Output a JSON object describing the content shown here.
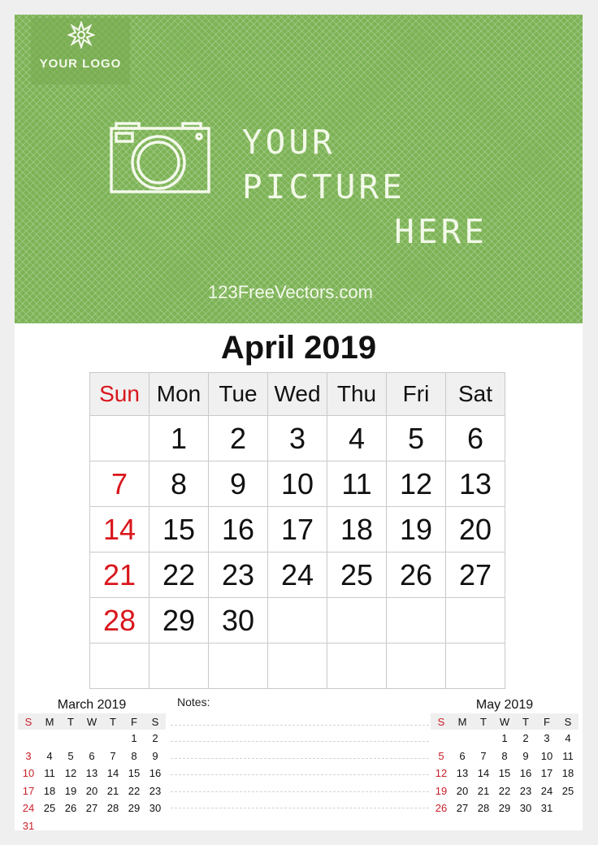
{
  "header": {
    "logo_text": "YOUR LOGO",
    "logo_icon": "flower-icon",
    "picture_line1": "YOUR PICTURE",
    "picture_line2": "HERE",
    "picture_icon": "camera-icon",
    "website": "123FreeVectors.com",
    "background_color": "#7db356"
  },
  "main": {
    "title": "April 2019",
    "weekdays": [
      "Sun",
      "Mon",
      "Tue",
      "Wed",
      "Thu",
      "Fri",
      "Sat"
    ],
    "weeks": [
      [
        "",
        "1",
        "2",
        "3",
        "4",
        "5",
        "6"
      ],
      [
        "7",
        "8",
        "9",
        "10",
        "11",
        "12",
        "13"
      ],
      [
        "14",
        "15",
        "16",
        "17",
        "18",
        "19",
        "20"
      ],
      [
        "21",
        "22",
        "23",
        "24",
        "25",
        "26",
        "27"
      ],
      [
        "28",
        "29",
        "30",
        "",
        "",
        "",
        ""
      ],
      [
        "",
        "",
        "",
        "",
        "",
        "",
        ""
      ]
    ],
    "sunday_color": "#d9161c"
  },
  "prev_month": {
    "title": "March 2019",
    "weekdays": [
      "S",
      "M",
      "T",
      "W",
      "T",
      "F",
      "S"
    ],
    "weeks": [
      [
        "",
        "",
        "",
        "",
        "",
        "1",
        "2"
      ],
      [
        "3",
        "4",
        "5",
        "6",
        "7",
        "8",
        "9"
      ],
      [
        "10",
        "11",
        "12",
        "13",
        "14",
        "15",
        "16"
      ],
      [
        "17",
        "18",
        "19",
        "20",
        "21",
        "22",
        "23"
      ],
      [
        "24",
        "25",
        "26",
        "27",
        "28",
        "29",
        "30"
      ],
      [
        "31",
        "",
        "",
        "",
        "",
        "",
        ""
      ]
    ]
  },
  "next_month": {
    "title": "May 2019",
    "weekdays": [
      "S",
      "M",
      "T",
      "W",
      "T",
      "F",
      "S"
    ],
    "weeks": [
      [
        "",
        "",
        "",
        "1",
        "2",
        "3",
        "4"
      ],
      [
        "5",
        "6",
        "7",
        "8",
        "9",
        "10",
        "11"
      ],
      [
        "12",
        "13",
        "14",
        "15",
        "16",
        "17",
        "18"
      ],
      [
        "19",
        "20",
        "21",
        "22",
        "23",
        "24",
        "25"
      ],
      [
        "26",
        "27",
        "28",
        "29",
        "30",
        "31",
        ""
      ]
    ]
  },
  "notes": {
    "label": "Notes:",
    "line_count": 6
  }
}
